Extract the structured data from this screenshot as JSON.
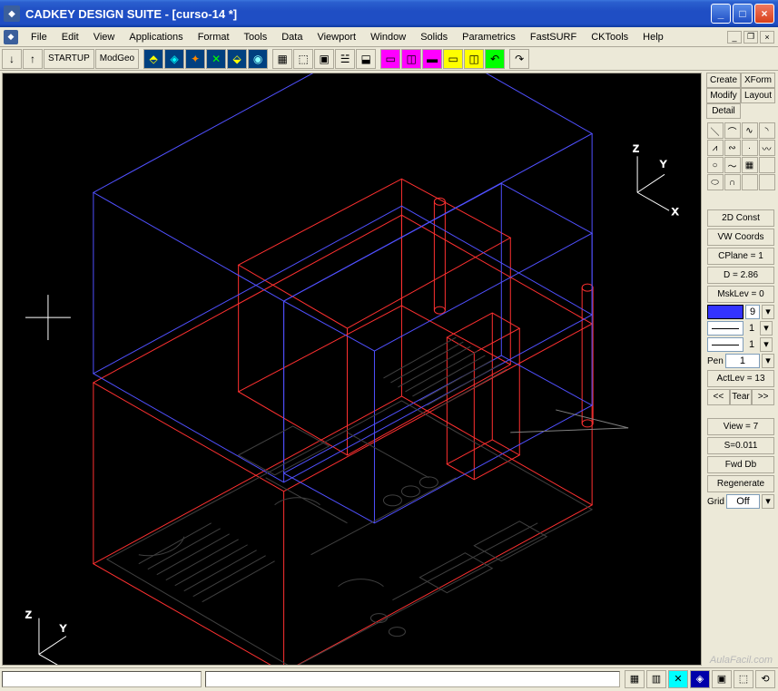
{
  "title": "CADKEY DESIGN SUITE - [curso-14 *]",
  "menu": [
    "File",
    "Edit",
    "View",
    "Applications",
    "Format",
    "Tools",
    "Data",
    "Viewport",
    "Window",
    "Solids",
    "Parametrics",
    "FastSURF",
    "CKTools",
    "Help"
  ],
  "toolbar": {
    "startup": "STARTUP",
    "modgeo": "ModGeo"
  },
  "tabs": {
    "create": "Create",
    "xform": "XForm",
    "modify": "Modify",
    "layout": "Layout",
    "detail": "Detail"
  },
  "side": {
    "const2d": "2D Const",
    "vwcoords": "VW Coords",
    "cplane": "CPlane = 1",
    "d_val": "D = 2.86",
    "msklev": "MskLev = 0",
    "color_num": "9",
    "line1": "1",
    "line2": "1",
    "pen_label": "Pen",
    "pen_val": "1",
    "actlev": "ActLev = 13",
    "arrow_left": "<<",
    "tear": "Tear",
    "arrow_right": ">>",
    "view": "View = 7",
    "scale": "S=0.011",
    "fwddb": "Fwd Db",
    "regenerate": "Regenerate",
    "grid_label": "Grid",
    "grid_val": "Off"
  },
  "axes": {
    "x": "X",
    "y": "Y",
    "z": "Z"
  },
  "watermark": "AulaFacil.com"
}
